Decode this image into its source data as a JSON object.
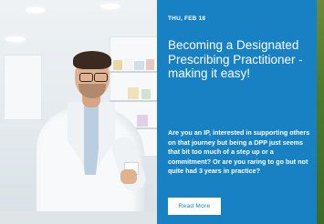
{
  "post": {
    "date": "THU, FEB 18",
    "title": "Becoming a Designated Prescribing Practitioner - making it easy!",
    "excerpt": "Are you an IP, interested in supporting others on that journey but being a DPP just seems that bit too much of a step up or a commitment? Or are you raring to go but not quite had 3 years in practice?",
    "read_more_label": "Read More",
    "image": "pharmacist-photo"
  },
  "colors": {
    "panel": "#1781c3",
    "text": "#ffffff",
    "button_bg": "#ffffff",
    "button_text": "#1781c3"
  }
}
